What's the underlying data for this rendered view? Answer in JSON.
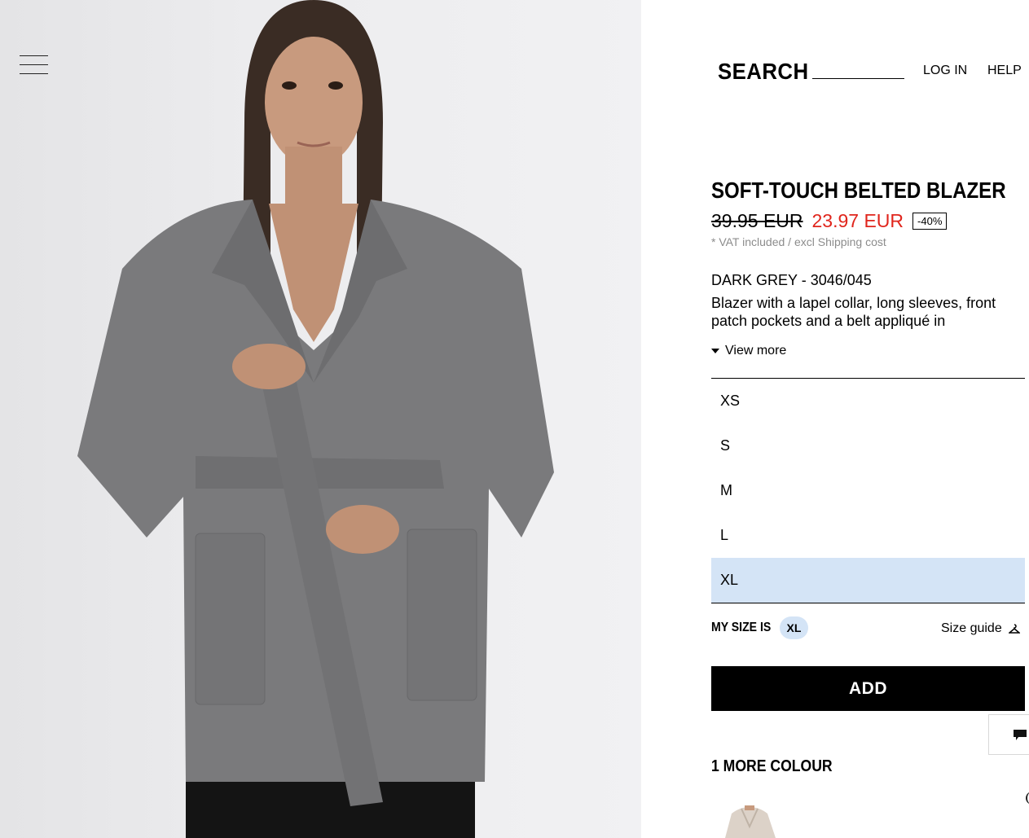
{
  "header": {
    "search_label": "SEARCH",
    "search_placeholder": "",
    "login": "LOG IN",
    "help": "HELP"
  },
  "product": {
    "title": "SOFT-TOUCH BELTED BLAZER",
    "old_price": "39.95 EUR",
    "new_price": "23.97 EUR",
    "discount": "-40%",
    "vat_note": "* VAT included / excl Shipping cost",
    "colour_ref": "DARK GREY - 3046/045",
    "description": "Blazer with a lapel collar, long sleeves, front patch pockets and a belt appliqué in",
    "view_more": "View more"
  },
  "sizes": [
    {
      "label": "XS",
      "selected": false
    },
    {
      "label": "S",
      "selected": false
    },
    {
      "label": "M",
      "selected": false
    },
    {
      "label": "L",
      "selected": false
    },
    {
      "label": "XL",
      "selected": true
    }
  ],
  "my_size": {
    "label": "MY SIZE IS",
    "value": "XL"
  },
  "size_guide": "Size guide",
  "add_button": "ADD",
  "more_colours": "1 MORE COLOUR",
  "colors": {
    "accent_price": "#e0251c",
    "selected_size_bg": "#d4e4f6",
    "add_button_bg": "#000000",
    "coat": "#7a7a7c"
  },
  "icons": [
    "menu-icon",
    "hanger-icon",
    "chat-icon",
    "chevron-left-icon"
  ]
}
